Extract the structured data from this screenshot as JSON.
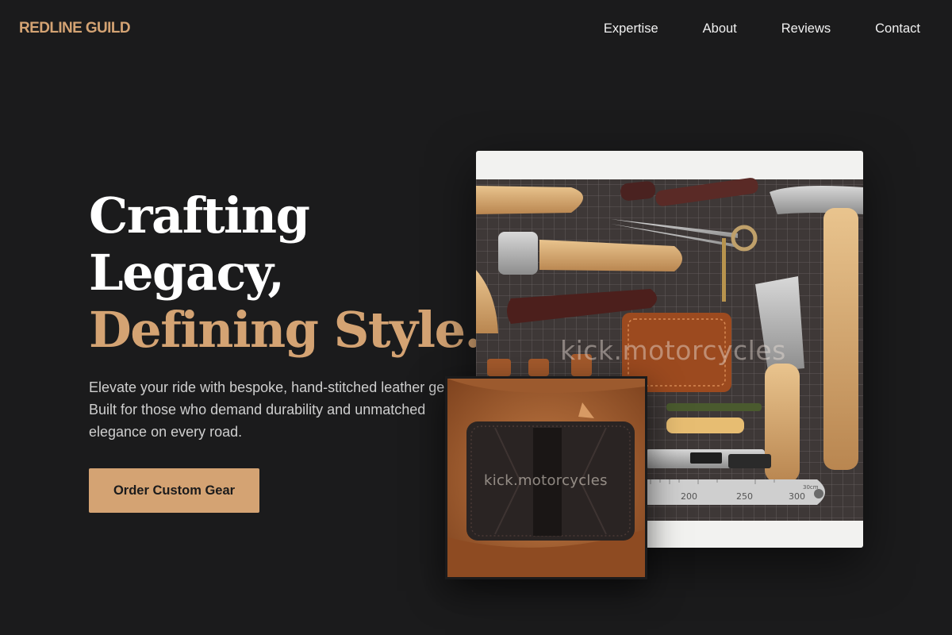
{
  "header": {
    "logo": "REDLINE GUILD",
    "nav": [
      "Expertise",
      "About",
      "Reviews",
      "Contact"
    ]
  },
  "hero": {
    "title_line1": "Crafting",
    "title_line2": "Legacy,",
    "title_accent": "Defining Style.",
    "description": "Elevate your ride with bespoke, hand-stitched leather gear. Built for those who demand durability and unmatched elegance on every road.",
    "cta_label": "Order Custom Gear"
  },
  "images": {
    "main_watermark": "kick.motorcycles",
    "secondary_watermark": "kick.motorcycles",
    "ruler_labels": [
      "200",
      "250",
      "300",
      "30cm"
    ]
  },
  "colors": {
    "background": "#1b1b1c",
    "accent": "#d4a373",
    "text": "#ffffff",
    "muted_text": "#cfcfcf"
  }
}
